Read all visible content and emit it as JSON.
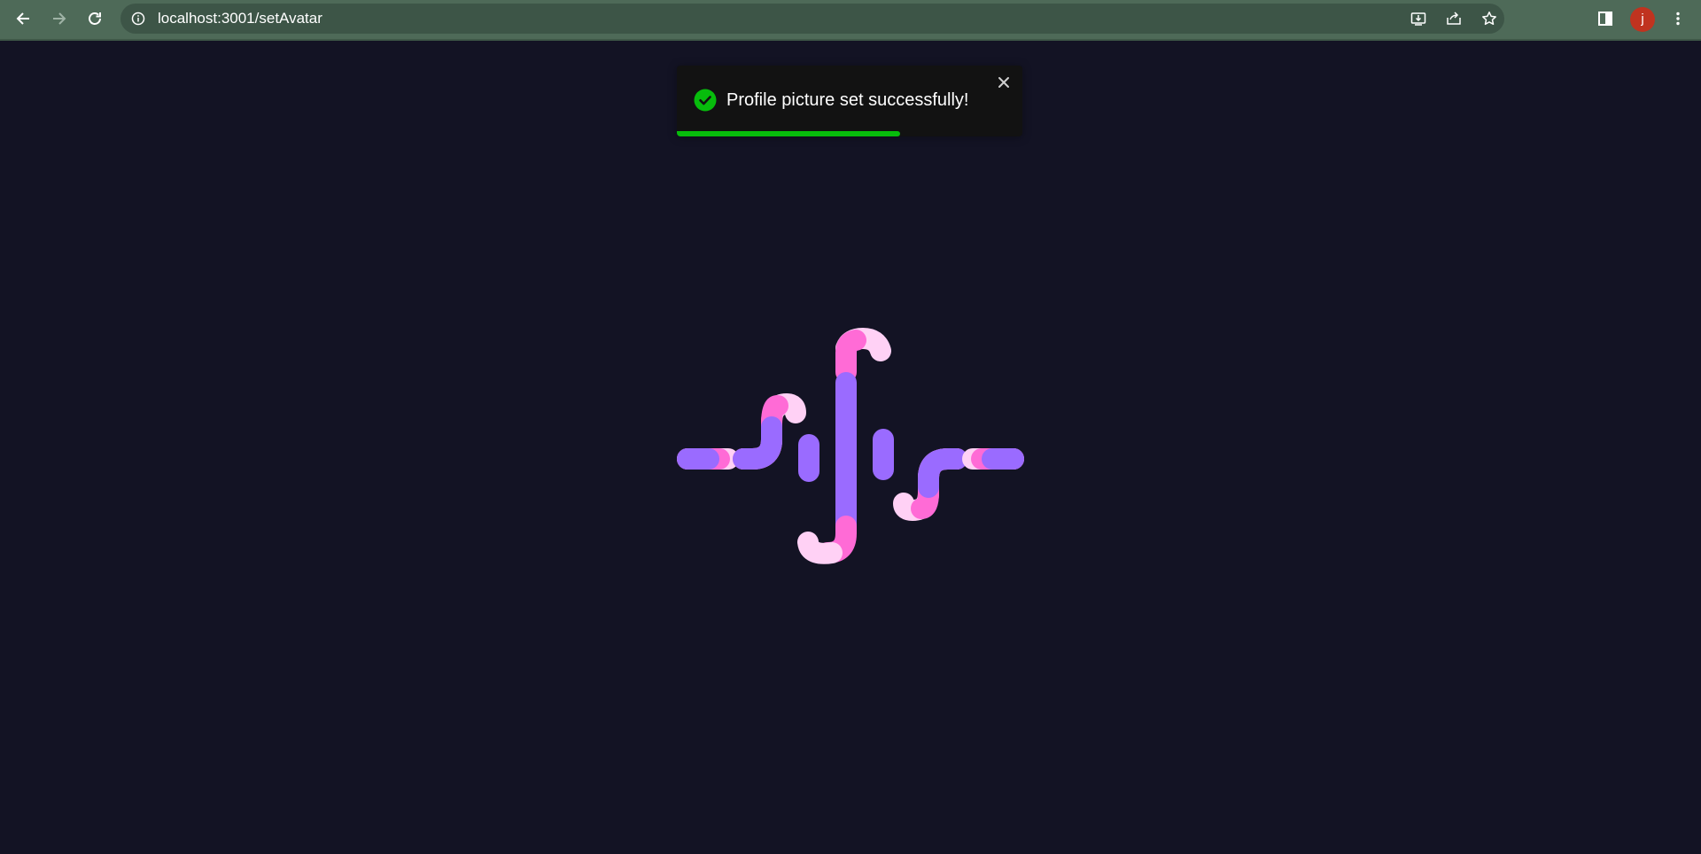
{
  "browser": {
    "url": "localhost:3001/setAvatar",
    "profile_initial": "j",
    "icons": {
      "back": "arrow-left-icon",
      "forward": "arrow-right-icon",
      "reload": "reload-icon",
      "site_info": "info-icon",
      "install": "install-app-icon",
      "share": "share-icon",
      "bookmark": "star-icon",
      "side_panel": "side-panel-icon",
      "menu": "kebab-menu-icon"
    }
  },
  "toast": {
    "message": "Profile picture set successfully!",
    "type": "success",
    "progress": 0.645,
    "colors": {
      "background": "#121212",
      "progress": "#07bc0c",
      "icon": "#07bc0c"
    }
  },
  "page": {
    "background": "#131324",
    "loader": {
      "colors": {
        "purple": "#9a6bff",
        "pink": "#ff6bd6",
        "light_pink": "#ffd1f5"
      }
    }
  }
}
